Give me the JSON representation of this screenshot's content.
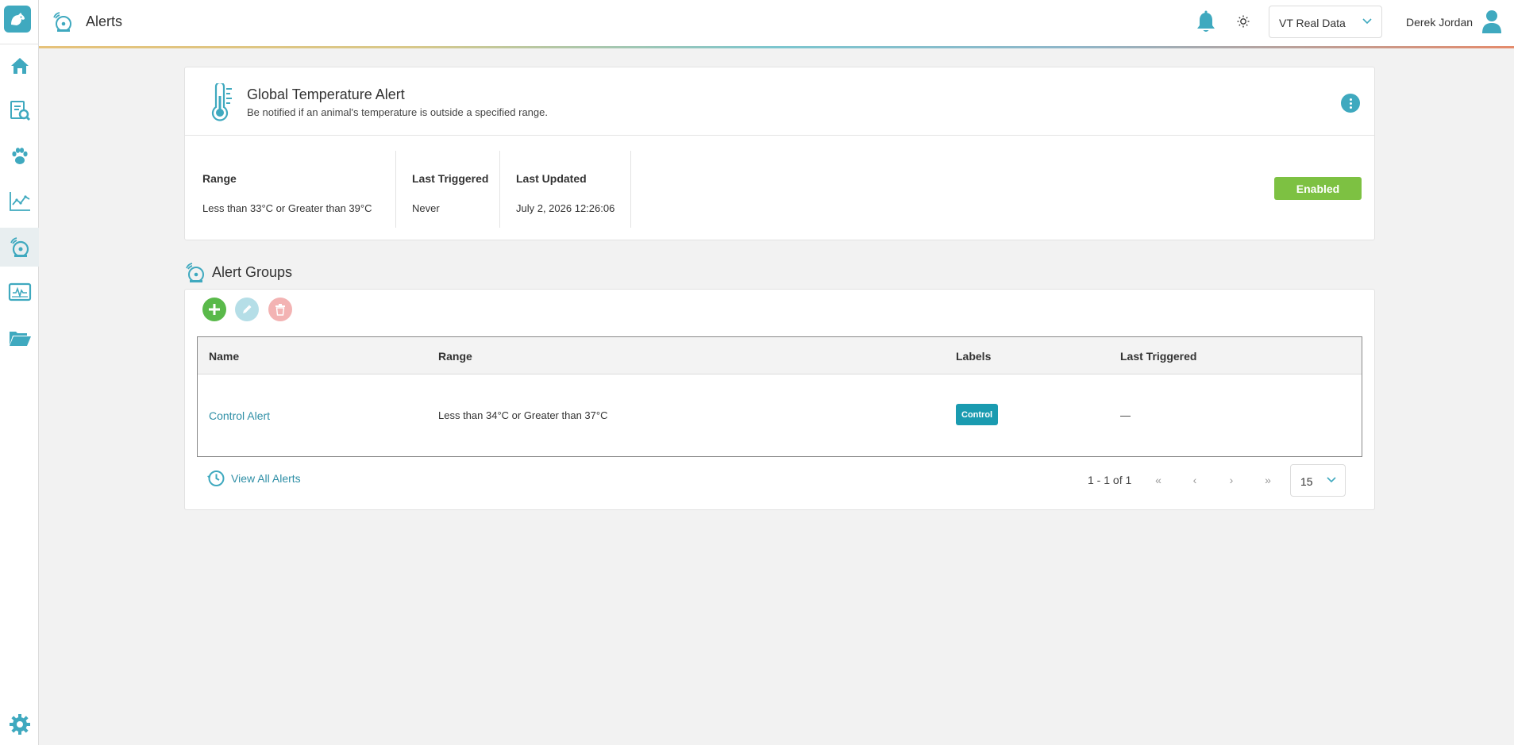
{
  "header": {
    "title": "Alerts",
    "dataset": "VT Real Data",
    "user_name": "Derek Jordan"
  },
  "sidebar": {
    "items": [
      {
        "icon": "home-icon"
      },
      {
        "icon": "report-search-icon"
      },
      {
        "icon": "paw-icon"
      },
      {
        "icon": "chart-icon"
      },
      {
        "icon": "alarm-icon",
        "active": true
      },
      {
        "icon": "monitor-icon"
      },
      {
        "icon": "folder-icon"
      }
    ],
    "settings_icon": "gear-icon"
  },
  "alert": {
    "title": "Global Temperature Alert",
    "description": "Be notified if an animal's temperature is outside a specified range.",
    "stats": {
      "range_label": "Range",
      "range_value": "Less than 33°C or Greater than 39°C",
      "last_triggered_label": "Last Triggered",
      "last_triggered_value": "Never",
      "last_updated_label": "Last Updated",
      "last_updated_value": "July 2, 2026 12:26:06"
    },
    "status": "Enabled"
  },
  "groups": {
    "title": "Alert Groups",
    "columns": [
      "Name",
      "Range",
      "Labels",
      "Last Triggered"
    ],
    "rows": [
      {
        "name": "Control Alert",
        "range": "Less than 34°C or Greater than 37°C",
        "label": "Control",
        "last_triggered": "—"
      }
    ],
    "view_all": "View All Alerts",
    "page_info": "1 - 1 of 1",
    "pager": {
      "first": "«",
      "prev": "‹",
      "next": "›",
      "last": "»"
    },
    "per_page": "15"
  },
  "colors": {
    "accent": "#3fa9bf",
    "enabled": "#7dc142",
    "add": "#59b94a",
    "label_badge": "#1a9bb0"
  }
}
